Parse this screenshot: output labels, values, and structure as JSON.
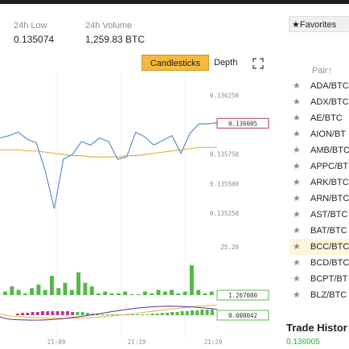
{
  "stats": {
    "low_label": "24h Low",
    "low_value": "0.135074",
    "volume_label": "24h Volume",
    "volume_value": "1,259.83 BTC"
  },
  "chart_controls": {
    "candlesticks_label": "Candlesticks",
    "depth_label": "Depth",
    "expand_icon": "expand-icon"
  },
  "chart": {
    "price_ticks": [
      "0.136250",
      "0.136005",
      "0.135750",
      "0.135500",
      "0.135250"
    ],
    "current_price_tag": "0.136005",
    "volume_top_label": "25.20",
    "volume_tag": "1.267000",
    "indicator_tag": "0.000042",
    "time_ticks": [
      "21:09",
      "21:19",
      "21:29"
    ],
    "price_line_color": "#5b8ed6",
    "ma_line_color": "#e0b43c",
    "volume_bar_color": "#54b948",
    "tag_border_color": "#b03a5b"
  },
  "chart_data": {
    "type": "line",
    "x_labels": [
      "21:09",
      "21:19",
      "21:29"
    ],
    "ylim": [
      0.1351,
      0.1363
    ],
    "price_series": [
      0.13588,
      0.1359,
      0.13593,
      0.13587,
      0.13584,
      0.1356,
      0.13528,
      0.1357,
      0.13574,
      0.13585,
      0.13582,
      0.13588,
      0.13585,
      0.1357,
      0.13572,
      0.13593,
      0.13589,
      0.13582,
      0.13586,
      0.1359,
      0.13575,
      0.13592,
      0.136,
      0.136,
      0.13601
    ],
    "ma_series": [
      0.13578,
      0.13578,
      0.13578,
      0.13577,
      0.13577,
      0.13576,
      0.13575,
      0.13574,
      0.13573,
      0.13573,
      0.13572,
      0.13572,
      0.13572,
      0.13572,
      0.13573,
      0.13573,
      0.13574,
      0.13575,
      0.13576,
      0.13577,
      0.13578,
      0.13579,
      0.1358,
      0.1358,
      0.1358
    ],
    "volume_ylim": [
      0,
      25.2
    ],
    "volume": [
      2,
      5,
      3,
      1,
      4,
      6,
      3,
      11,
      4,
      7,
      3,
      13,
      7,
      5,
      1,
      2,
      1,
      1,
      2,
      0.5,
      0.5,
      2,
      1,
      3,
      2,
      3,
      1,
      2,
      17,
      3,
      1,
      2
    ]
  },
  "sidebar": {
    "favorites_label": "Favorites",
    "pair_header": "Pair",
    "pairs": [
      "ADA/BTC",
      "ADX/BTC",
      "AE/BTC",
      "AION/BT",
      "AMB/BTC",
      "APPC/BT",
      "ARK/BTC",
      "ARN/BTC",
      "AST/BTC",
      "BAT/BTC",
      "BCC/BTC",
      "BCD/BTC",
      "BCPT/BT",
      "BLZ/BTC"
    ],
    "active_index": 10
  },
  "trade_history": {
    "title": "Trade Histor",
    "first_price": "0.136005"
  }
}
